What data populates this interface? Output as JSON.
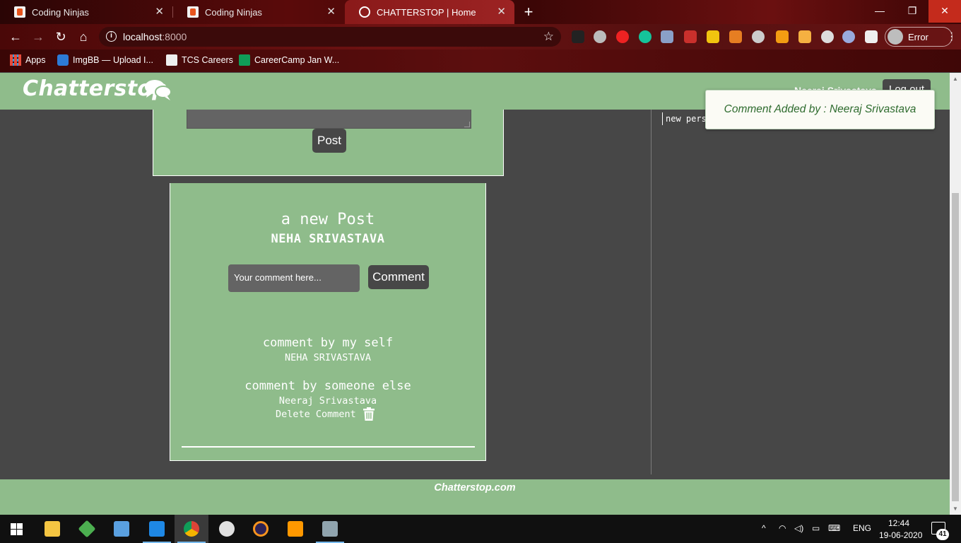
{
  "browser": {
    "tabs": [
      {
        "title": "Coding Ninjas",
        "active": false
      },
      {
        "title": "Coding Ninjas",
        "active": false
      },
      {
        "title": "CHATTERSTOP | Home",
        "active": true
      }
    ],
    "url_host": "localhost",
    "url_port": ":8000",
    "profile_label": "Error",
    "bookmarks": [
      "Apps",
      "ImgBB — Upload I...",
      "TCS Careers",
      "CareerCamp Jan W..."
    ]
  },
  "app": {
    "brand": "Chatterstop",
    "header_user": "Neeraj Srivastava",
    "logout_label": "Log out",
    "post_button": "Post",
    "post": {
      "content": "a new Post",
      "author": "NEHA SRIVASTAVA",
      "comment_placeholder": "Your comment here...",
      "comment_button": "Comment",
      "comments": [
        {
          "content": "comment by my self",
          "author": "NEHA SRIVASTAVA"
        },
        {
          "content": "comment by someone else",
          "author": "Neeraj Srivastava",
          "delete_label": "Delete Comment"
        }
      ]
    },
    "sidebar_text": "new pers",
    "toast": "Comment Added by : Neeraj Srivastava",
    "footer": "Chatterstop.com",
    "colors": {
      "theme_green": "#8fbc8b",
      "dark_gray": "#474747",
      "toast_text": "#2e6b2e"
    }
  },
  "taskbar": {
    "lang": "ENG",
    "time": "12:44",
    "date": "19-06-2020",
    "notification_count": "41"
  }
}
